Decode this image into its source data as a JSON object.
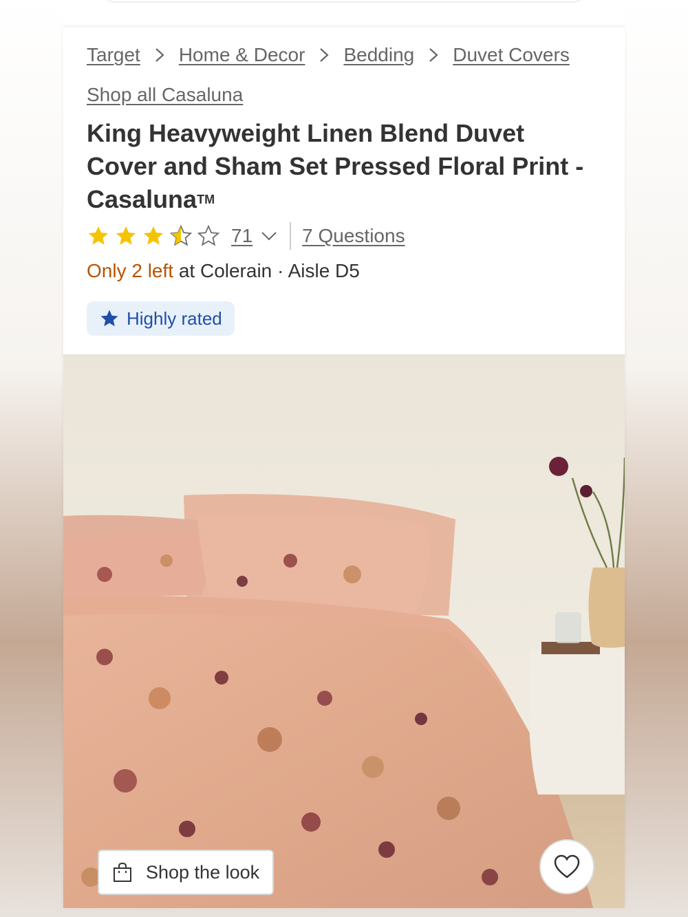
{
  "breadcrumb": {
    "items": [
      {
        "label": "Target"
      },
      {
        "label": "Home & Decor"
      },
      {
        "label": "Bedding"
      },
      {
        "label": "Duvet Covers"
      }
    ]
  },
  "brand_link": "Shop all Casaluna",
  "product": {
    "title": "King Heavyweight Linen Blend Duvet Cover and Sham Set Pressed Floral Print - Casaluna",
    "trademark": "TM",
    "rating_stars": 3.5,
    "review_count": "71",
    "questions_label": "7 Questions",
    "stock": {
      "low_text": "Only 2 left",
      "location_text": " at Colerain · Aisle D5"
    },
    "badge_label": "Highly rated"
  },
  "actions": {
    "shop_look_label": "Shop the look"
  },
  "icons": {
    "breadcrumb_separator": "chevron-right-icon",
    "star": "star-icon",
    "review_toggle": "chevron-down-icon",
    "badge": "star-filled-icon",
    "shop_look": "shopping-bag-icon",
    "favorite": "heart-icon"
  },
  "colors": {
    "star": "#f5c400",
    "low_stock": "#b85300",
    "badge_bg": "#e8f0fa",
    "badge_text": "#1f4fa8"
  }
}
